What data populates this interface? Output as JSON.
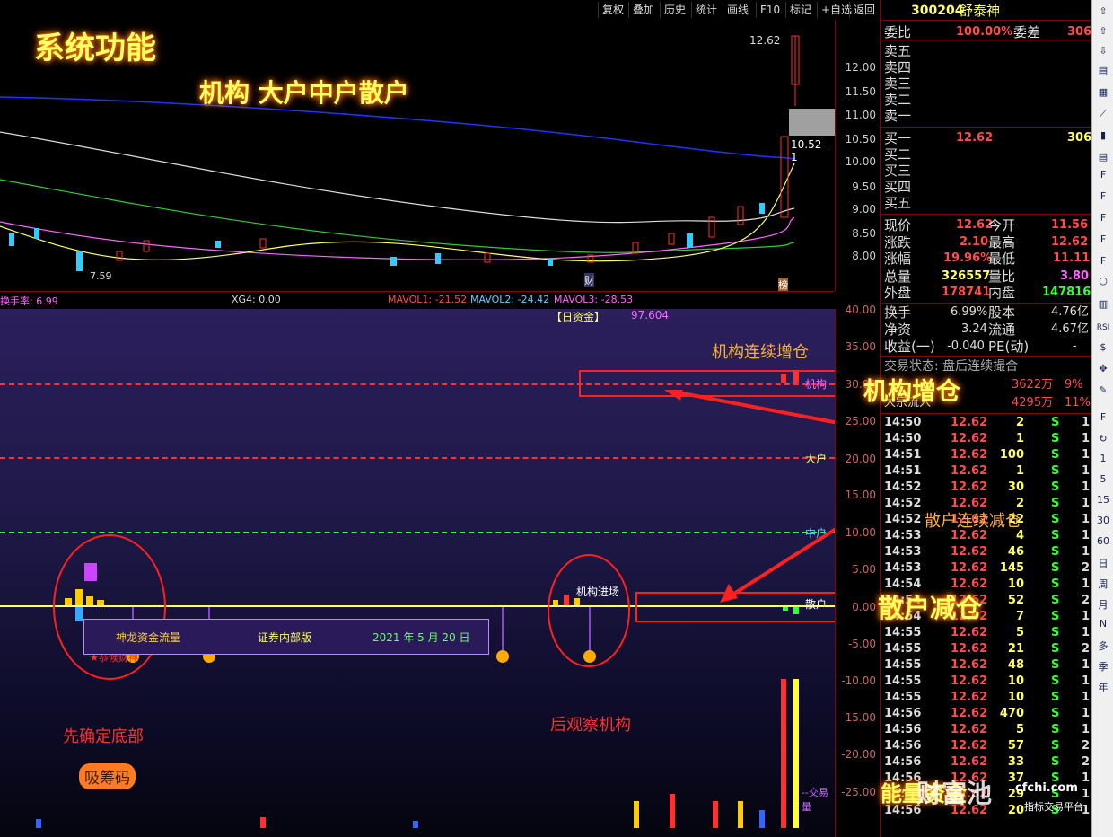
{
  "toolbar": [
    "复权",
    "叠加",
    "历史",
    "统计",
    "画线",
    "F10",
    "标记",
    "+自选",
    "返回"
  ],
  "main_chart": {
    "overlay_title": "系统功能",
    "overlay_subtitle": "机构 大户中户散户",
    "high_label": "12.62",
    "low_label": "7.59",
    "price_label": "10.52 - 1",
    "marker_cai": "财",
    "marker_bang": "榜",
    "y_ticks": [
      "12.00",
      "11.50",
      "11.00",
      "10.50",
      "10.00",
      "9.50",
      "9.00",
      "8.50",
      "8.00"
    ]
  },
  "info_bar": {
    "turnover": "换手率: 6.99",
    "xg4": "XG4: 0.00",
    "mavol1": "MAVOL1: -21.52",
    "mavol2": "MAVOL2: -24.42",
    "mavol3": "MAVOL3: -28.53"
  },
  "indicator": {
    "legend_name": "神龙资金流量",
    "legend_edition": "证券内部版",
    "legend_date": "2021 年 5 月 20 日",
    "daily_fund_label": "【日资金】",
    "daily_fund_value": "97.604",
    "y_ticks": [
      "40.00",
      "35.00",
      "30.00",
      "25.00",
      "20.00",
      "15.00",
      "10.00",
      "5.00",
      "0.00",
      "-5.00",
      "-10.00",
      "-15.00",
      "-20.00",
      "-25.00"
    ],
    "line_jigou": "机构",
    "line_dahu": "大户",
    "line_zhonghu": "中户",
    "line_sanhu": "散户",
    "note_jigou_continuous": "机构连续增仓",
    "note_jigou_add": "机构增仓",
    "note_sanhu_continuous": "散户连续减仓",
    "note_sanhu_reduce": "散户减仓",
    "note_enter": "机构进场",
    "note_first_bottom": "先确定底部",
    "note_absorb": "吸筹码",
    "note_observe": "后观察机构",
    "note_star": "★恭候财神",
    "note_volume": "--交易量",
    "colors": {
      "jigou": "#ff3030",
      "dahu": "#ff3030",
      "zhonghu": "#33ff33",
      "sanhu": "#ffff00"
    }
  },
  "right_panel": {
    "code": "300204",
    "name": "舒泰神",
    "weibi_label": "委比",
    "weibi_value": "100.00%",
    "weicha_label": "委差",
    "weicha_value": "306",
    "sell": [
      "卖五",
      "卖四",
      "卖三",
      "卖二",
      "卖一"
    ],
    "buy": [
      {
        "label": "买一",
        "price": "12.62",
        "vol": "306"
      },
      {
        "label": "买二",
        "price": "",
        "vol": ""
      },
      {
        "label": "买三",
        "price": "",
        "vol": ""
      },
      {
        "label": "买四",
        "price": "",
        "vol": ""
      },
      {
        "label": "买五",
        "price": "",
        "vol": ""
      }
    ],
    "stats": [
      {
        "k1": "现价",
        "v1": "12.62",
        "k2": "今开",
        "v2": "11.56"
      },
      {
        "k1": "涨跌",
        "v1": "2.10",
        "k2": "最高",
        "v2": "12.62"
      },
      {
        "k1": "涨幅",
        "v1": "19.96%",
        "k2": "最低",
        "v2": "11.11"
      },
      {
        "k1": "总量",
        "v1": "326557",
        "k2": "量比",
        "v2": "3.80"
      },
      {
        "k1": "外盘",
        "v1": "178741",
        "k2": "内盘",
        "v2": "147816"
      },
      {
        "k1": "换手",
        "v1": "6.99%",
        "k2": "股本",
        "v2": "4.76亿"
      },
      {
        "k1": "净资",
        "v1": "3.24",
        "k2": "流通",
        "v2": "4.67亿"
      },
      {
        "k1": "收益(一)",
        "v1": "-0.040",
        "k2": "PE(动)",
        "v2": "-"
      }
    ],
    "trade_status": "交易状态: 盘后连续撮合",
    "flow1_label": "",
    "flow1_value": "3622万",
    "flow1_pct": "9%",
    "flow2_label": "大宗流入",
    "flow2_value": "4295万",
    "flow2_pct": "11%",
    "trades": [
      {
        "t": "14:50",
        "p": "12.62",
        "v": "2",
        "s": "S",
        "n": "1"
      },
      {
        "t": "14:50",
        "p": "12.62",
        "v": "1",
        "s": "S",
        "n": "1"
      },
      {
        "t": "14:51",
        "p": "12.62",
        "v": "100",
        "s": "S",
        "n": "1"
      },
      {
        "t": "14:51",
        "p": "12.62",
        "v": "1",
        "s": "S",
        "n": "1"
      },
      {
        "t": "14:52",
        "p": "12.62",
        "v": "30",
        "s": "S",
        "n": "1"
      },
      {
        "t": "14:52",
        "p": "12.62",
        "v": "2",
        "s": "S",
        "n": "1"
      },
      {
        "t": "14:52",
        "p": "12.62",
        "v": "22",
        "s": "S",
        "n": "1"
      },
      {
        "t": "14:53",
        "p": "12.62",
        "v": "4",
        "s": "S",
        "n": "1"
      },
      {
        "t": "14:53",
        "p": "12.62",
        "v": "46",
        "s": "S",
        "n": "1"
      },
      {
        "t": "14:53",
        "p": "12.62",
        "v": "145",
        "s": "S",
        "n": "2"
      },
      {
        "t": "14:54",
        "p": "12.62",
        "v": "10",
        "s": "S",
        "n": "1"
      },
      {
        "t": "14:54",
        "p": "12.62",
        "v": "52",
        "s": "S",
        "n": "2"
      },
      {
        "t": "14:54",
        "p": "12.62",
        "v": "7",
        "s": "S",
        "n": "1"
      },
      {
        "t": "14:55",
        "p": "12.62",
        "v": "5",
        "s": "S",
        "n": "1"
      },
      {
        "t": "14:55",
        "p": "12.62",
        "v": "21",
        "s": "S",
        "n": "2"
      },
      {
        "t": "14:55",
        "p": "12.62",
        "v": "48",
        "s": "S",
        "n": "1"
      },
      {
        "t": "14:55",
        "p": "12.62",
        "v": "10",
        "s": "S",
        "n": "1"
      },
      {
        "t": "14:55",
        "p": "12.62",
        "v": "10",
        "s": "S",
        "n": "1"
      },
      {
        "t": "14:56",
        "p": "12.62",
        "v": "470",
        "s": "S",
        "n": "1"
      },
      {
        "t": "14:56",
        "p": "12.62",
        "v": "5",
        "s": "S",
        "n": "1"
      },
      {
        "t": "14:56",
        "p": "12.62",
        "v": "57",
        "s": "S",
        "n": "2"
      },
      {
        "t": "14:56",
        "p": "12.62",
        "v": "33",
        "s": "S",
        "n": "2"
      },
      {
        "t": "14:56",
        "p": "12.62",
        "v": "37",
        "s": "S",
        "n": "1"
      },
      {
        "t": "14:56",
        "p": "12.62",
        "v": "29",
        "s": "S",
        "n": "1"
      },
      {
        "t": "14:56",
        "p": "12.62",
        "v": "20",
        "s": "S",
        "n": "1"
      }
    ],
    "watermark_big": "能量资金",
    "watermark_logo": "财富池",
    "watermark_site": "cfchi.com",
    "watermark_sub": "指标交易平台"
  },
  "tools_periods": [
    "1",
    "5",
    "15",
    "30",
    "60",
    "日",
    "周",
    "月",
    "N",
    "多",
    "季",
    "年"
  ]
}
